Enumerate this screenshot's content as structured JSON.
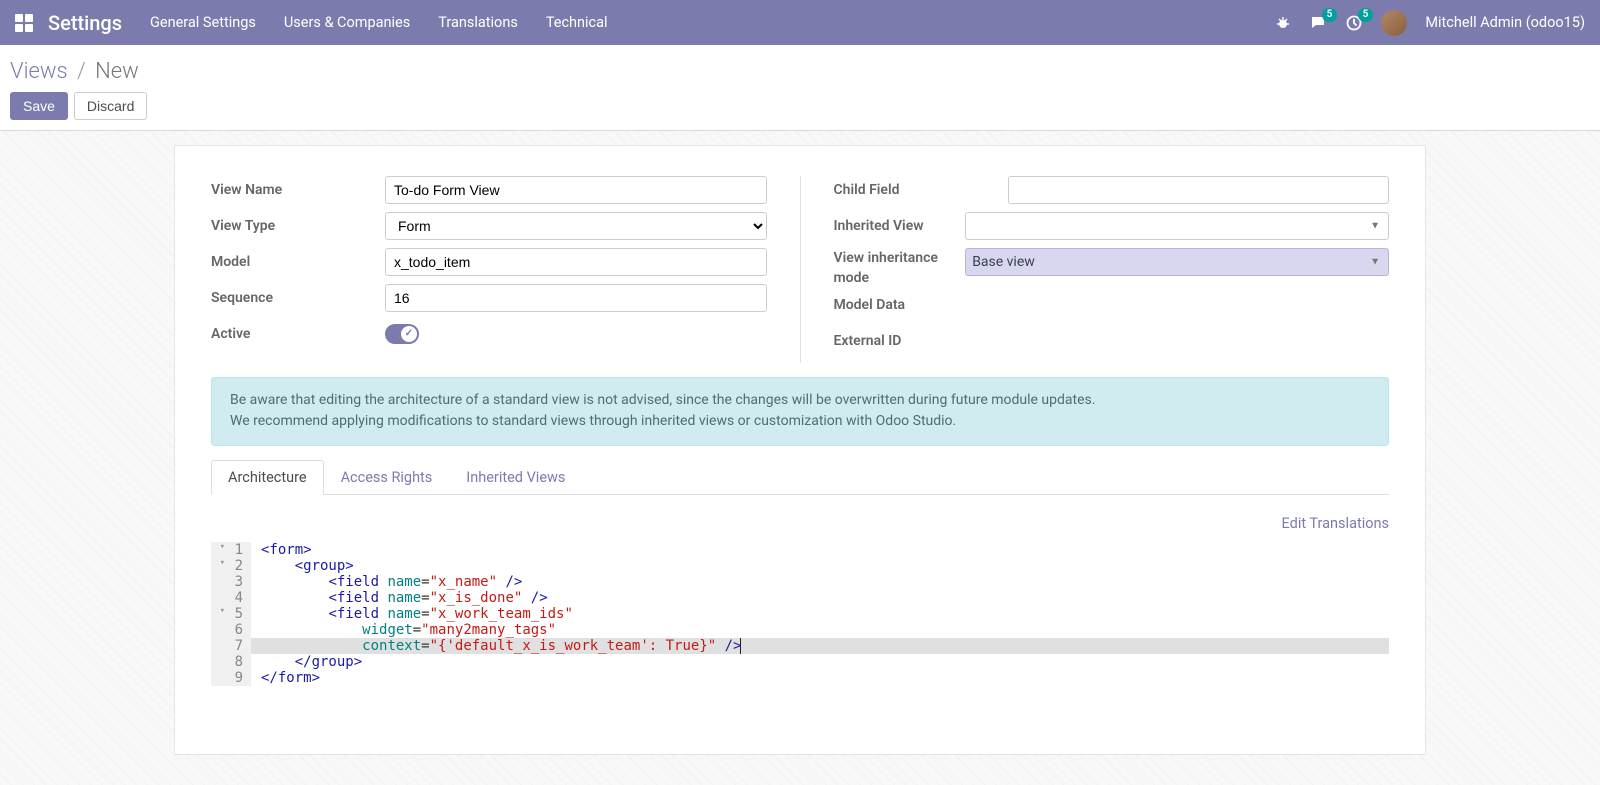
{
  "navbar": {
    "brand": "Settings",
    "menu": [
      "General Settings",
      "Users & Companies",
      "Translations",
      "Technical"
    ],
    "chat_badge": "5",
    "activity_badge": "5",
    "user": "Mitchell Admin (odoo15)"
  },
  "breadcrumb": {
    "root": "Views",
    "current": "New"
  },
  "buttons": {
    "save": "Save",
    "discard": "Discard"
  },
  "form": {
    "left": {
      "view_name": {
        "label": "View Name",
        "value": "To-do Form View"
      },
      "view_type": {
        "label": "View Type",
        "value": "Form"
      },
      "model": {
        "label": "Model",
        "value": "x_todo_item"
      },
      "sequence": {
        "label": "Sequence",
        "value": "16"
      },
      "active": {
        "label": "Active",
        "value": true
      }
    },
    "right": {
      "child_field": {
        "label": "Child Field",
        "value": ""
      },
      "inherited_view": {
        "label": "Inherited View",
        "value": ""
      },
      "inherit_mode": {
        "label": "View inheritance mode",
        "value": "Base view"
      },
      "model_data": {
        "label": "Model Data"
      },
      "external_id": {
        "label": "External ID"
      }
    }
  },
  "alert": {
    "l1": "Be aware that editing the architecture of a standard view is not advised, since the changes will be overwritten during future module updates.",
    "l2": "We recommend applying modifications to standard views through inherited views or customization with Odoo Studio."
  },
  "tabs": {
    "arch": "Architecture",
    "access": "Access Rights",
    "inherited": "Inherited Views"
  },
  "edit_translations": "Edit Translations",
  "code": {
    "lines": [
      {
        "n": 1,
        "fold": true,
        "hl": false,
        "html": "<span class='t-tag'>&lt;form&gt;</span>"
      },
      {
        "n": 2,
        "fold": true,
        "hl": false,
        "html": "    <span class='t-tag'>&lt;group&gt;</span>"
      },
      {
        "n": 3,
        "fold": false,
        "hl": false,
        "html": "        <span class='t-tag'>&lt;field</span> <span class='t-attr'>name</span>=<span class='t-str'>\"x_name\"</span> <span class='t-tag'>/&gt;</span>"
      },
      {
        "n": 4,
        "fold": false,
        "hl": false,
        "html": "        <span class='t-tag'>&lt;field</span> <span class='t-attr'>name</span>=<span class='t-str'>\"x_is_done\"</span> <span class='t-tag'>/&gt;</span>"
      },
      {
        "n": 5,
        "fold": true,
        "hl": false,
        "html": "        <span class='t-tag'>&lt;field</span> <span class='t-attr'>name</span>=<span class='t-str'>\"x_work_team_ids\"</span>"
      },
      {
        "n": 6,
        "fold": false,
        "hl": false,
        "html": "            <span class='t-attr'>widget</span>=<span class='t-str'>\"many2many_tags\"</span>"
      },
      {
        "n": 7,
        "fold": false,
        "hl": true,
        "html": "            <span class='t-attr'>context</span>=<span class='t-str'>\"{'default_x_is_work_team': True}\"</span> <span class='t-tag'>/&gt;</span><span class='cursor'></span>"
      },
      {
        "n": 8,
        "fold": false,
        "hl": false,
        "html": "    <span class='t-tag'>&lt;/group&gt;</span>"
      },
      {
        "n": 9,
        "fold": false,
        "hl": false,
        "html": "<span class='t-tag'>&lt;/form&gt;</span>"
      }
    ]
  }
}
